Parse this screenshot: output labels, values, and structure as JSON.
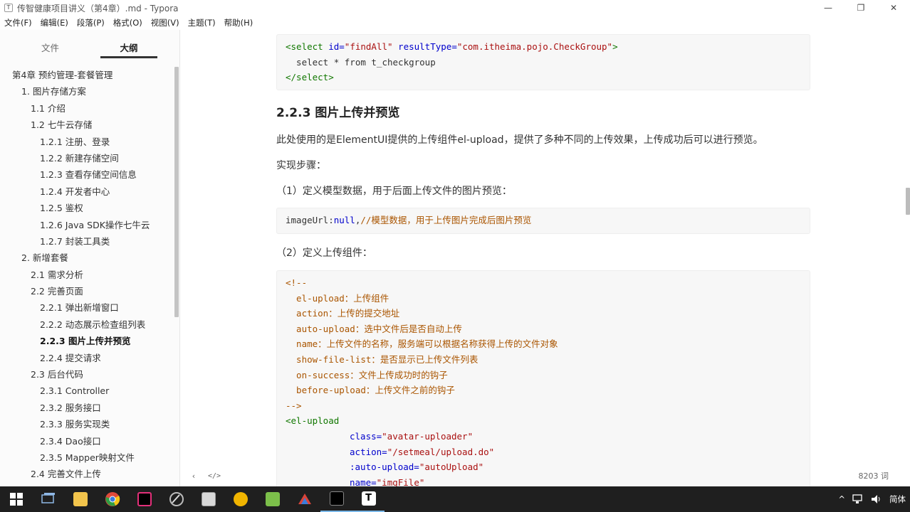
{
  "window": {
    "title": "传智健康项目讲义（第4章）.md - Typora",
    "app_icon_letter": "T",
    "minimize": "—",
    "restore": "❐",
    "close": "✕"
  },
  "menu": [
    "文件(F)",
    "编辑(E)",
    "段落(P)",
    "格式(O)",
    "视图(V)",
    "主题(T)",
    "帮助(H)"
  ],
  "sidebar": {
    "tabs": [
      "文件",
      "大纲"
    ],
    "active_tab": "大纲",
    "outline": [
      {
        "label": "第4章 预约管理-套餐管理",
        "level": 1
      },
      {
        "label": "1. 图片存储方案",
        "level": 2
      },
      {
        "label": "1.1 介绍",
        "level": 3
      },
      {
        "label": "1.2 七牛云存储",
        "level": 3
      },
      {
        "label": "1.2.1 注册、登录",
        "level": 4
      },
      {
        "label": "1.2.2 新建存储空间",
        "level": 4
      },
      {
        "label": "1.2.3 查看存储空间信息",
        "level": 4
      },
      {
        "label": "1.2.4 开发者中心",
        "level": 4
      },
      {
        "label": "1.2.5 鉴权",
        "level": 4
      },
      {
        "label": "1.2.6 Java SDK操作七牛云",
        "level": 4
      },
      {
        "label": "1.2.7 封装工具类",
        "level": 4
      },
      {
        "label": "2. 新增套餐",
        "level": 2
      },
      {
        "label": "2.1 需求分析",
        "level": 3
      },
      {
        "label": "2.2 完善页面",
        "level": 3
      },
      {
        "label": "2.2.1 弹出新增窗口",
        "level": 4
      },
      {
        "label": "2.2.2 动态展示检查组列表",
        "level": 4
      },
      {
        "label": "2.2.3 图片上传并预览",
        "level": 4,
        "active": true
      },
      {
        "label": "2.2.4 提交请求",
        "level": 4
      },
      {
        "label": "2.3 后台代码",
        "level": 3
      },
      {
        "label": "2.3.1 Controller",
        "level": 4
      },
      {
        "label": "2.3.2 服务接口",
        "level": 4
      },
      {
        "label": "2.3.3 服务实现类",
        "level": 4
      },
      {
        "label": "2.3.4 Dao接口",
        "level": 4
      },
      {
        "label": "2.3.5 Mapper映射文件",
        "level": 4
      },
      {
        "label": "2.4 完善文件上传",
        "level": 3
      }
    ]
  },
  "content": {
    "code1": {
      "l1_open": "<select ",
      "l1_id_attr": "id=",
      "l1_id_val": "\"findAll\"",
      "l1_rt_attr": " resultType=",
      "l1_rt_val": "\"com.itheima.pojo.CheckGroup\"",
      "l1_close": ">",
      "l2": "  select * from t_checkgroup",
      "l3": "</select>"
    },
    "heading": "2.2.3 图片上传并预览",
    "p1": "此处使用的是ElementUI提供的上传组件el-upload，提供了多种不同的上传效果，上传成功后可以进行预览。",
    "p2": "实现步骤：",
    "p3": "（1）定义模型数据，用于后面上传文件的图片预览：",
    "code2": {
      "var": "imageUrl:",
      "kw": "null",
      "comma": ",",
      "cmt": "//模型数据，用于上传图片完成后图片预览"
    },
    "p4": "（2）定义上传组件：",
    "code3": {
      "c0": "<!--",
      "c1": "  el-upload：上传组件",
      "c2": "  action：上传的提交地址",
      "c3": "  auto-upload：选中文件后是否自动上传",
      "c4": "  name：上传文件的名称，服务端可以根据名称获得上传的文件对象",
      "c5": "  show-file-list：是否显示已上传文件列表",
      "c6": "  on-success：文件上传成功时的钩子",
      "c7": "  before-upload：上传文件之前的钩子",
      "c8": "-->",
      "tag": "<el-upload",
      "a1": "class=",
      "v1": "\"avatar-uploader\"",
      "a2": "action=",
      "v2": "\"/setmeal/upload.do\"",
      "a3": ":auto-upload=",
      "v3": "\"autoUpload\"",
      "a4": "name=",
      "v4": "\"imgFile\""
    }
  },
  "status": {
    "back": "‹",
    "source": "</>",
    "words": "8203 词"
  },
  "taskbar": {
    "tray_up": "^",
    "ime": "简体"
  }
}
